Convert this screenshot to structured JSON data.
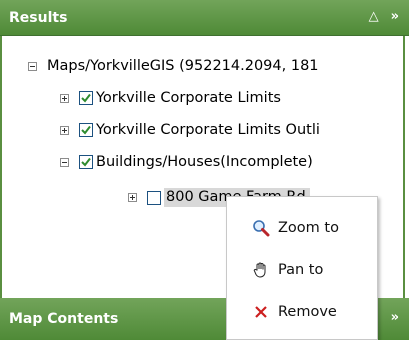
{
  "results_panel": {
    "title": "Results",
    "collapse_glyph": "△",
    "expand_glyph": "»"
  },
  "tree": {
    "root_label": "Maps/YorkvilleGIS (952214.2094, 181",
    "children": [
      {
        "label": "Yorkville Corporate Limits",
        "checked": true
      },
      {
        "label": "Yorkville Corporate Limits Outli",
        "checked": true
      },
      {
        "label": "Buildings/Houses(Incomplete)",
        "checked": true
      }
    ],
    "grandchild": {
      "label": "800 Game Farm Rd",
      "checked": false
    }
  },
  "scrollbar": {
    "left_arrow": "<",
    "right_arrow": ">"
  },
  "contents_panel": {
    "title": "Map Contents",
    "expand_glyph": "»"
  },
  "context_menu": {
    "items": [
      {
        "label": "Zoom to",
        "icon": "magnifier-icon"
      },
      {
        "label": "Pan to",
        "icon": "hand-icon"
      },
      {
        "label": "Remove",
        "icon": "x-icon"
      }
    ]
  },
  "colors": {
    "header_green": "#5a8f40",
    "check_green": "#2e8b2e",
    "remove_red": "#cc1f1f"
  }
}
